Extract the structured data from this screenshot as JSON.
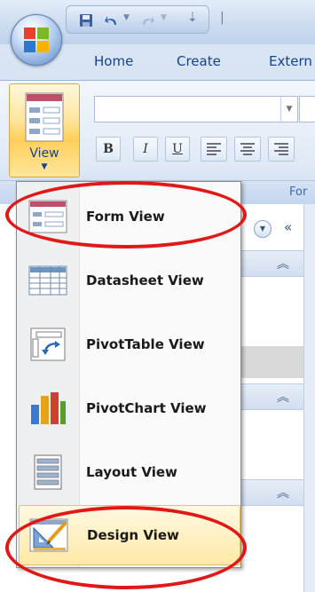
{
  "ribbon": {
    "tabs": [
      "Home",
      "Create",
      "Extern"
    ],
    "view_button_label": "View",
    "format_buttons": [
      "B",
      "I",
      "U"
    ],
    "group_label": "For"
  },
  "view_menu": {
    "items": [
      {
        "label": "Form View",
        "icon": "form-view-icon"
      },
      {
        "label": "Datasheet View",
        "icon": "datasheet-view-icon"
      },
      {
        "label": "PivotTable View",
        "icon": "pivottable-view-icon"
      },
      {
        "label": "PivotChart View",
        "icon": "pivotchart-view-icon"
      },
      {
        "label": "Layout View",
        "icon": "layout-view-icon"
      },
      {
        "label": "Design View",
        "icon": "design-view-icon",
        "highlighted": true
      }
    ]
  },
  "annotations": {
    "ring_color": "#e01818",
    "circled_items": [
      "Form View",
      "Design View"
    ]
  },
  "colors": {
    "ribbon_text": "#15428b",
    "highlight": "#ffe9a6"
  }
}
